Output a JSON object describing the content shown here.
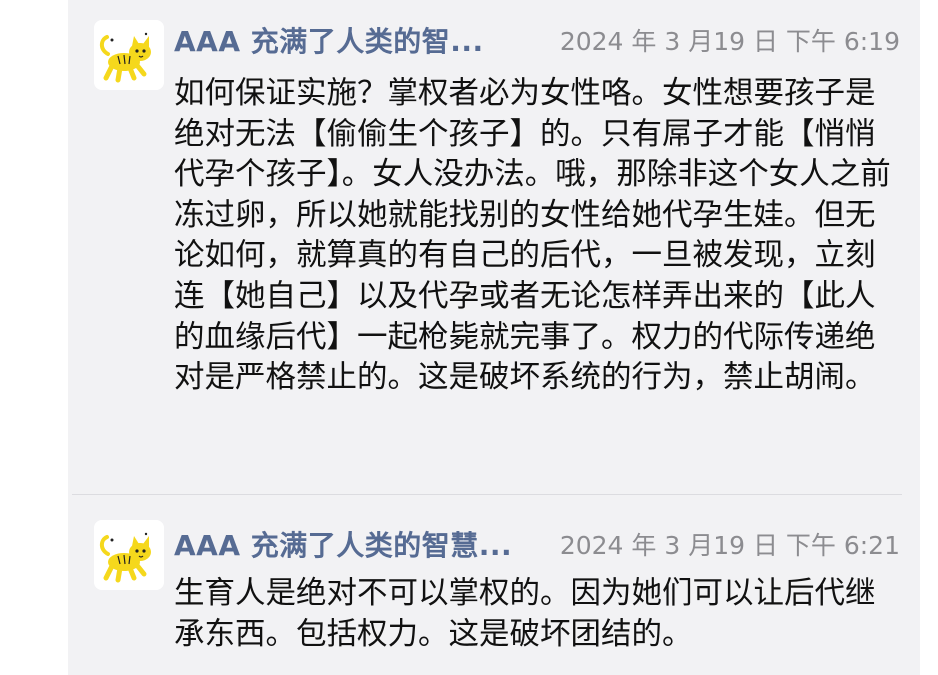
{
  "posts": [
    {
      "author": "AAA 充满了人类的智...",
      "timestamp": "2024 年 3 月19 日 下午 6:19",
      "avatar_icon": "cat-icon",
      "body": "如何保证实施？掌权者必为女性咯。女性想要孩子是绝对无法【偷偷生个孩子】的。只有屌子才能【悄悄代孕个孩子】。女人没办法。哦，那除非这个女人之前冻过卵，所以她就能找别的女性给她代孕生娃。但无论如何，就算真的有自己的后代，一旦被发现，立刻连【她自己】以及代孕或者无论怎样弄出来的【此人的血缘后代】一起枪毙就完事了。权力的代际传递绝对是严格禁止的。这是破坏系统的行为，禁止胡闹。"
    },
    {
      "author": "AAA 充满了人类的智慧...",
      "timestamp": "2024 年 3 月19 日 下午 6:21",
      "avatar_icon": "cat-icon",
      "body": "生育人是绝对不可以掌权的。因为她们可以让后代继承东西。包括权力。这是破坏团结的。"
    }
  ],
  "colors": {
    "author": "#566b93",
    "timestamp": "#8c8c90",
    "body": "#111111",
    "card_background": "#f2f2f4",
    "avatar_cat": "#f5d81c"
  }
}
